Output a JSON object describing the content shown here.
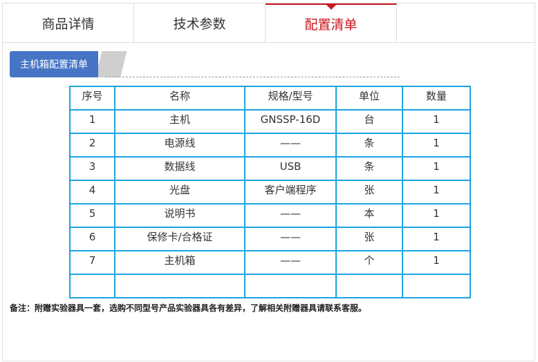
{
  "tabs": [
    {
      "label": "商品详情"
    },
    {
      "label": "技术参数"
    },
    {
      "label": "配置清单"
    },
    {
      "label": ""
    }
  ],
  "colors": {
    "active": "#c8161d",
    "tag_bg": "#4675c6",
    "table_border": "#1aa3e0"
  },
  "section": {
    "title": "主机箱配置清单"
  },
  "table": {
    "headers": [
      "序号",
      "名称",
      "规格/型号",
      "单位",
      "数量"
    ],
    "rows": [
      [
        "1",
        "主机",
        "GNSSP-16D",
        "台",
        "1"
      ],
      [
        "2",
        "电源线",
        "——",
        "条",
        "1"
      ],
      [
        "3",
        "数据线",
        "USB",
        "条",
        "1"
      ],
      [
        "4",
        "光盘",
        "客户端程序",
        "张",
        "1"
      ],
      [
        "5",
        "说明书",
        "——",
        "本",
        "1"
      ],
      [
        "6",
        "保修卡/合格证",
        "——",
        "张",
        "1"
      ],
      [
        "7",
        "主机箱",
        "——",
        "个",
        "1"
      ],
      [
        "",
        "",
        "",
        "",
        ""
      ]
    ]
  },
  "note": "备注：附赠实验器具一套，选购不同型号产品实验器具各有差异，了解相关附赠器具请联系客服。"
}
